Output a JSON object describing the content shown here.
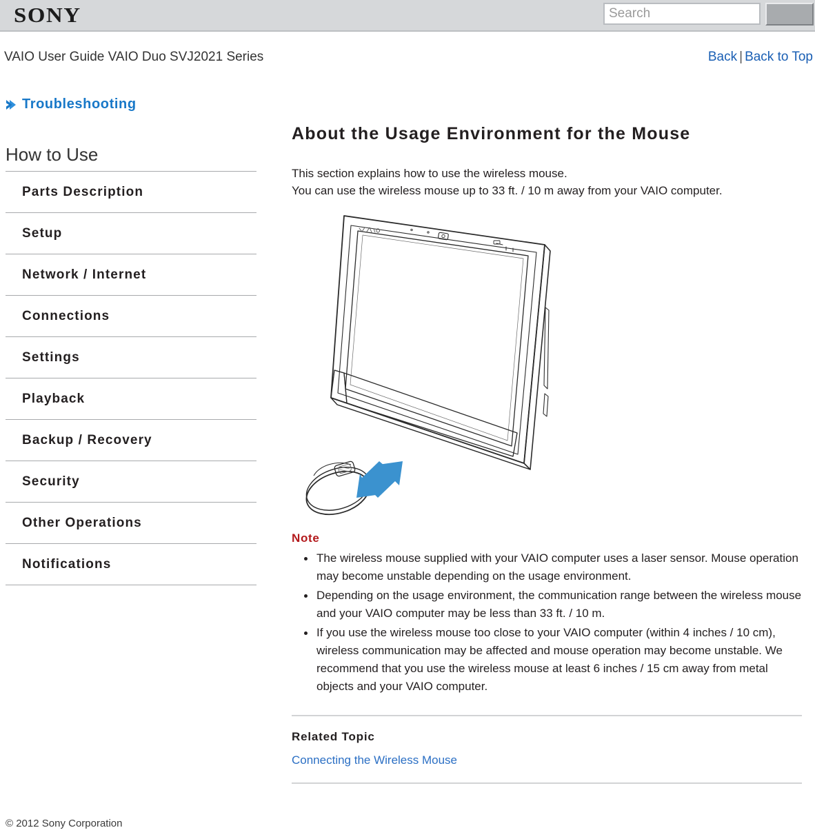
{
  "header": {
    "logo_text": "SONY",
    "search_placeholder": "Search",
    "search_value": "",
    "search_button_label": ""
  },
  "subheader": {
    "guide_title": "VAIO User Guide VAIO Duo SVJ2021 Series",
    "back_label": "Back",
    "separator": "|",
    "back_to_top_label": "Back to Top"
  },
  "sidebar": {
    "troubleshooting_label": "Troubleshooting",
    "section_title": "How to Use",
    "items": [
      {
        "label": "Parts Description"
      },
      {
        "label": "Setup"
      },
      {
        "label": "Network / Internet"
      },
      {
        "label": "Connections"
      },
      {
        "label": "Settings"
      },
      {
        "label": "Playback"
      },
      {
        "label": "Backup / Recovery"
      },
      {
        "label": "Security"
      },
      {
        "label": "Other Operations"
      },
      {
        "label": "Notifications"
      }
    ]
  },
  "main": {
    "title": "About the Usage Environment for the Mouse",
    "intro_line1": "This section explains how to use the wireless mouse.",
    "intro_line2": "You can use the wireless mouse up to 33 ft. / 10 m away from your VAIO computer.",
    "figure_caption": "",
    "note_title": "Note",
    "notes": [
      "The wireless mouse supplied with your VAIO computer uses a laser sensor. Mouse operation may become unstable depending on the usage environment.",
      "Depending on the usage environment, the communication range between the wireless mouse and your VAIO computer may be less than 33 ft. / 10 m.",
      "If you use the wireless mouse too close to your VAIO computer (within 4 inches / 10 cm), wireless communication may be affected and mouse operation may become unstable. We recommend that you use the wireless mouse at least 6 inches / 15 cm away from metal objects and your VAIO computer."
    ],
    "related_title": "Related Topic",
    "related_link": "Connecting the Wireless Mouse"
  },
  "footer": {
    "copyright": "© 2012 Sony Corporation"
  },
  "colors": {
    "header_band": "#d6d8da",
    "link_blue": "#1a5fb4",
    "troubleshooting_blue": "#1878c8",
    "note_red": "#b3191c",
    "arrow_blue": "#3b92cf",
    "related_link_blue": "#2b6fc4"
  }
}
